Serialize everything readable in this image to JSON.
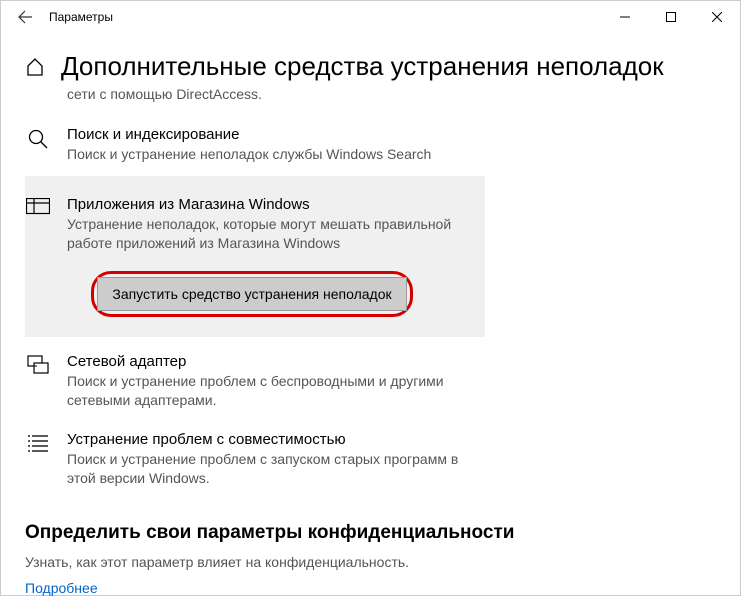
{
  "window": {
    "title": "Параметры"
  },
  "page": {
    "title": "Дополнительные средства устранения неполадок",
    "pre_text": "сети с помощью DirectAccess."
  },
  "items": {
    "search": {
      "title": "Поиск и индексирование",
      "desc": "Поиск и устранение неполадок службы Windows Search"
    },
    "store": {
      "title": "Приложения из Магазина Windows",
      "desc": "Устранение неполадок, которые могут мешать правильной работе приложений из Магазина Windows"
    },
    "network": {
      "title": "Сетевой адаптер",
      "desc": "Поиск и устранение проблем с беспроводными и другими сетевыми адаптерами."
    },
    "compat": {
      "title": "Устранение проблем с совместимостью",
      "desc": "Поиск и устранение проблем с запуском старых программ в этой версии Windows."
    }
  },
  "run_button": "Запустить средство устранения неполадок",
  "privacy": {
    "heading": "Определить свои параметры конфиденциальности",
    "sub": "Узнать, как этот параметр влияет на конфиденциальность.",
    "link": "Подробнее"
  }
}
